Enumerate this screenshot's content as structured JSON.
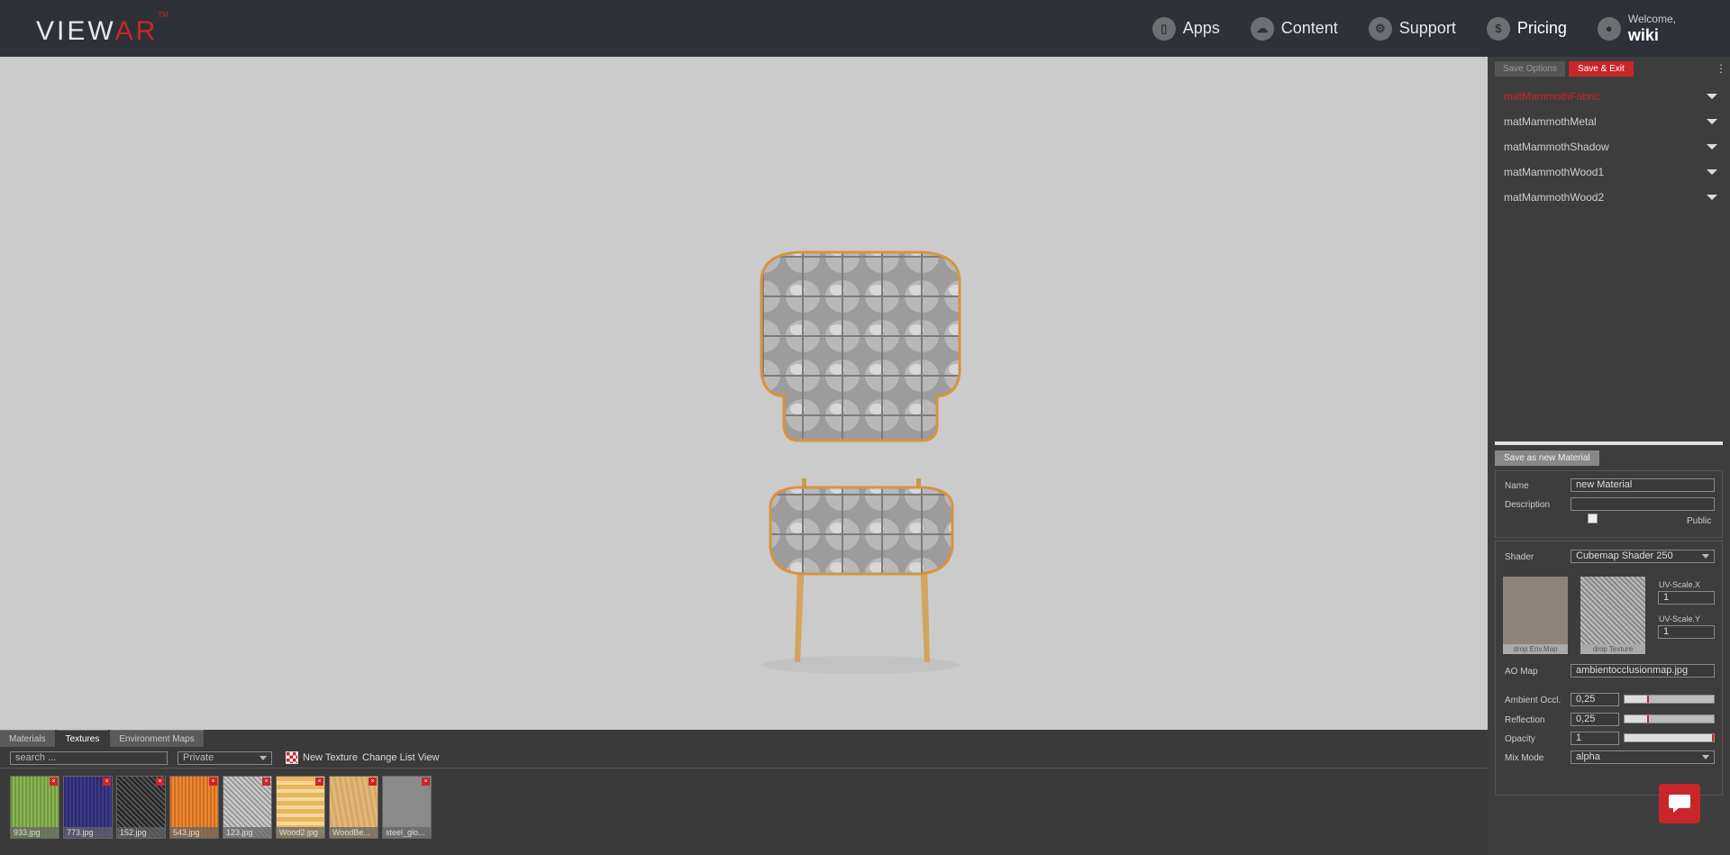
{
  "brand": {
    "logo_main": "VIEW",
    "logo_ar": "AR",
    "logo_tm": "TM"
  },
  "nav": [
    {
      "label": "Apps",
      "icon": "tablet-icon"
    },
    {
      "label": "Content",
      "icon": "cloud-icon"
    },
    {
      "label": "Support",
      "icon": "gear-icon"
    },
    {
      "label": "Pricing",
      "icon": "dollar-icon"
    }
  ],
  "user": {
    "welcome": "Welcome,",
    "name": "wiki"
  },
  "right_panel": {
    "save_options": "Save Options",
    "save_exit": "Save & Exit",
    "materials": [
      "matMammothFabric",
      "matMammothMetal",
      "matMammothShadow",
      "matMammothWood1",
      "matMammothWood2"
    ],
    "save_new": "Save as new Material",
    "name_label": "Name",
    "name_value": "new Material",
    "description_label": "Description",
    "description_value": "",
    "public_label": "Public",
    "shader_label": "Shader",
    "shader_value": "Cubemap Shader 250",
    "env_map_label": "drop Env.Map",
    "texture_label": "drop Texture",
    "uv_x_label": "UV-Scale.X",
    "uv_x_value": "1",
    "uv_y_label": "UV-Scale.Y",
    "uv_y_value": "1",
    "ao_label": "AO Map",
    "ao_value": "ambientocclusionmap.jpg",
    "ambient_label": "Ambient Occl.",
    "ambient_value": "0,25",
    "reflection_label": "Reflection",
    "reflection_value": "0,25",
    "opacity_label": "Opacity",
    "opacity_value": "1",
    "mix_label": "Mix Mode",
    "mix_value": "alpha"
  },
  "bottom": {
    "tabs": [
      "Materials",
      "Textures",
      "Environment Maps"
    ],
    "active_tab": "Textures",
    "search_placeholder": "search ...",
    "visibility": "Private",
    "new_texture": "New Texture",
    "change_view": "Change List View",
    "textures": [
      "933.jpg",
      "773.jpg",
      "152.jpg",
      "543.jpg",
      "123.jpg",
      "Wood2.jpg",
      "WoodBe...",
      "steel_glo..."
    ]
  },
  "colors": {
    "accent": "#c8262b",
    "topbar": "#2e3138",
    "viewport": "#cbcbcb"
  }
}
